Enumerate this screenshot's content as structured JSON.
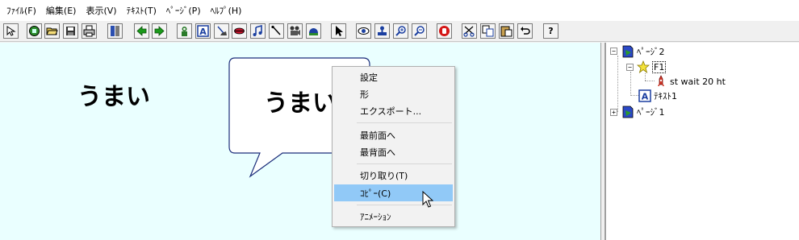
{
  "menu": {
    "items": [
      "ﾌｧｲﾙ(F)",
      "編集(E)",
      "表示(V)",
      "ﾃｷｽﾄ(T)",
      "ﾍﾟｰｼﾞ(P)",
      "ﾍﾙﾌﾟ(H)"
    ]
  },
  "toolbar": {
    "help_glyph": "?",
    "text_glyph": "A",
    "buttons": [
      "select-icon",
      "stop-icon",
      "open-folder-icon",
      "save-icon",
      "print-icon",
      "panel-icon",
      "back-arrow-icon",
      "forward-arrow-icon",
      "character-icon",
      "text-icon",
      "broom-icon",
      "lips-icon",
      "music-icon",
      "pen-icon",
      "camera-icon",
      "helmet-icon",
      "pointer-icon",
      "eye-icon",
      "stamp-icon",
      "zoom-in-icon",
      "zoom-out-icon",
      "hand-icon",
      "cut-icon",
      "copy-icon",
      "paste-icon",
      "undo-icon",
      "help-icon"
    ]
  },
  "canvas": {
    "background": "#eaffff",
    "text1": "うまい",
    "bubble_text": "うまい"
  },
  "context_menu": {
    "items": [
      {
        "label": "設定",
        "highlighted": false
      },
      {
        "label": "形",
        "highlighted": false
      },
      {
        "label": "エクスポート...",
        "highlighted": false
      },
      {
        "label": "最前面へ",
        "highlighted": false
      },
      {
        "label": "最背面へ",
        "highlighted": false
      },
      {
        "label": "切り取り(T)",
        "highlighted": false
      },
      {
        "label": "ｺﾋﾟｰ(C)",
        "highlighted": true
      },
      {
        "label": "ｱﾆﾒｰｼｮﾝ",
        "highlighted": false
      }
    ],
    "highlight_color": "#91c9f7"
  },
  "tree": {
    "expand_minus": "−",
    "expand_plus": "+",
    "nodes": [
      {
        "label": "ﾍﾟｰｼﾞ2",
        "icon": "page-icon",
        "expanded": true
      },
      {
        "label": "F1",
        "icon": "star-icon",
        "expanded": true,
        "selected": true
      },
      {
        "label": "st wait 20 ht",
        "icon": "rocket-icon"
      },
      {
        "label": "ﾃｷｽﾄ1",
        "icon": "text-icon"
      },
      {
        "label": "ﾍﾟｰｼﾞ1",
        "icon": "page-icon",
        "expanded": false
      }
    ]
  }
}
